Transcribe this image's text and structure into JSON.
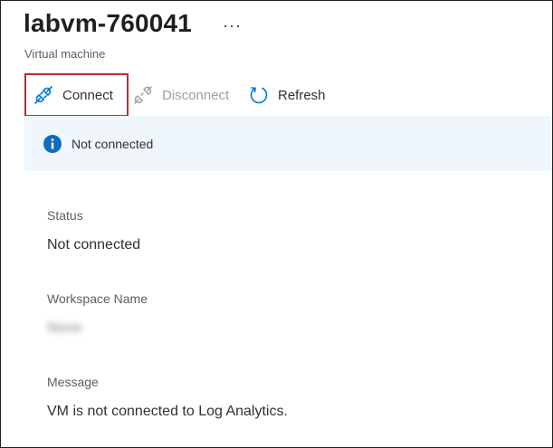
{
  "header": {
    "title": "labvm-760041",
    "more_label": "···",
    "subtitle": "Virtual machine"
  },
  "toolbar": {
    "connect_label": "Connect",
    "disconnect_label": "Disconnect",
    "refresh_label": "Refresh"
  },
  "banner": {
    "icon": "info-icon",
    "text": "Not connected"
  },
  "fields": {
    "status_label": "Status",
    "status_value": "Not connected",
    "workspace_label": "Workspace Name",
    "workspace_value": "None",
    "message_label": "Message",
    "message_value": "VM is not connected to Log Analytics."
  },
  "colors": {
    "accent": "#0078d4",
    "highlight_border": "#c4262e",
    "banner_bg": "#eff6fc"
  }
}
